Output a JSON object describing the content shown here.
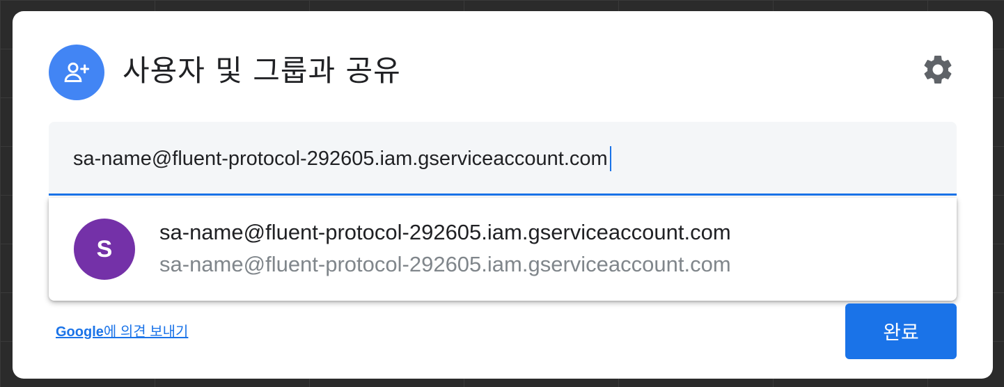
{
  "dialog": {
    "title": "사용자 및 그룹과 공유",
    "header_icon": "add-person-icon",
    "settings_icon": "gear-icon"
  },
  "share_input": {
    "value": "sa-name@fluent-protocol-292605.iam.gserviceaccount.com"
  },
  "suggestion": {
    "avatar_letter": "S",
    "avatar_color": "#7431a8",
    "name": "sa-name@fluent-protocol-292605.iam.gserviceaccount.com",
    "email": "sa-name@fluent-protocol-292605.iam.gserviceaccount.com"
  },
  "footer": {
    "feedback_brand": "Google",
    "feedback_text": "에 의견 보내기",
    "done_label": "완료"
  },
  "colors": {
    "accent": "#1a73e8",
    "header_icon_bg": "#4285f4"
  }
}
